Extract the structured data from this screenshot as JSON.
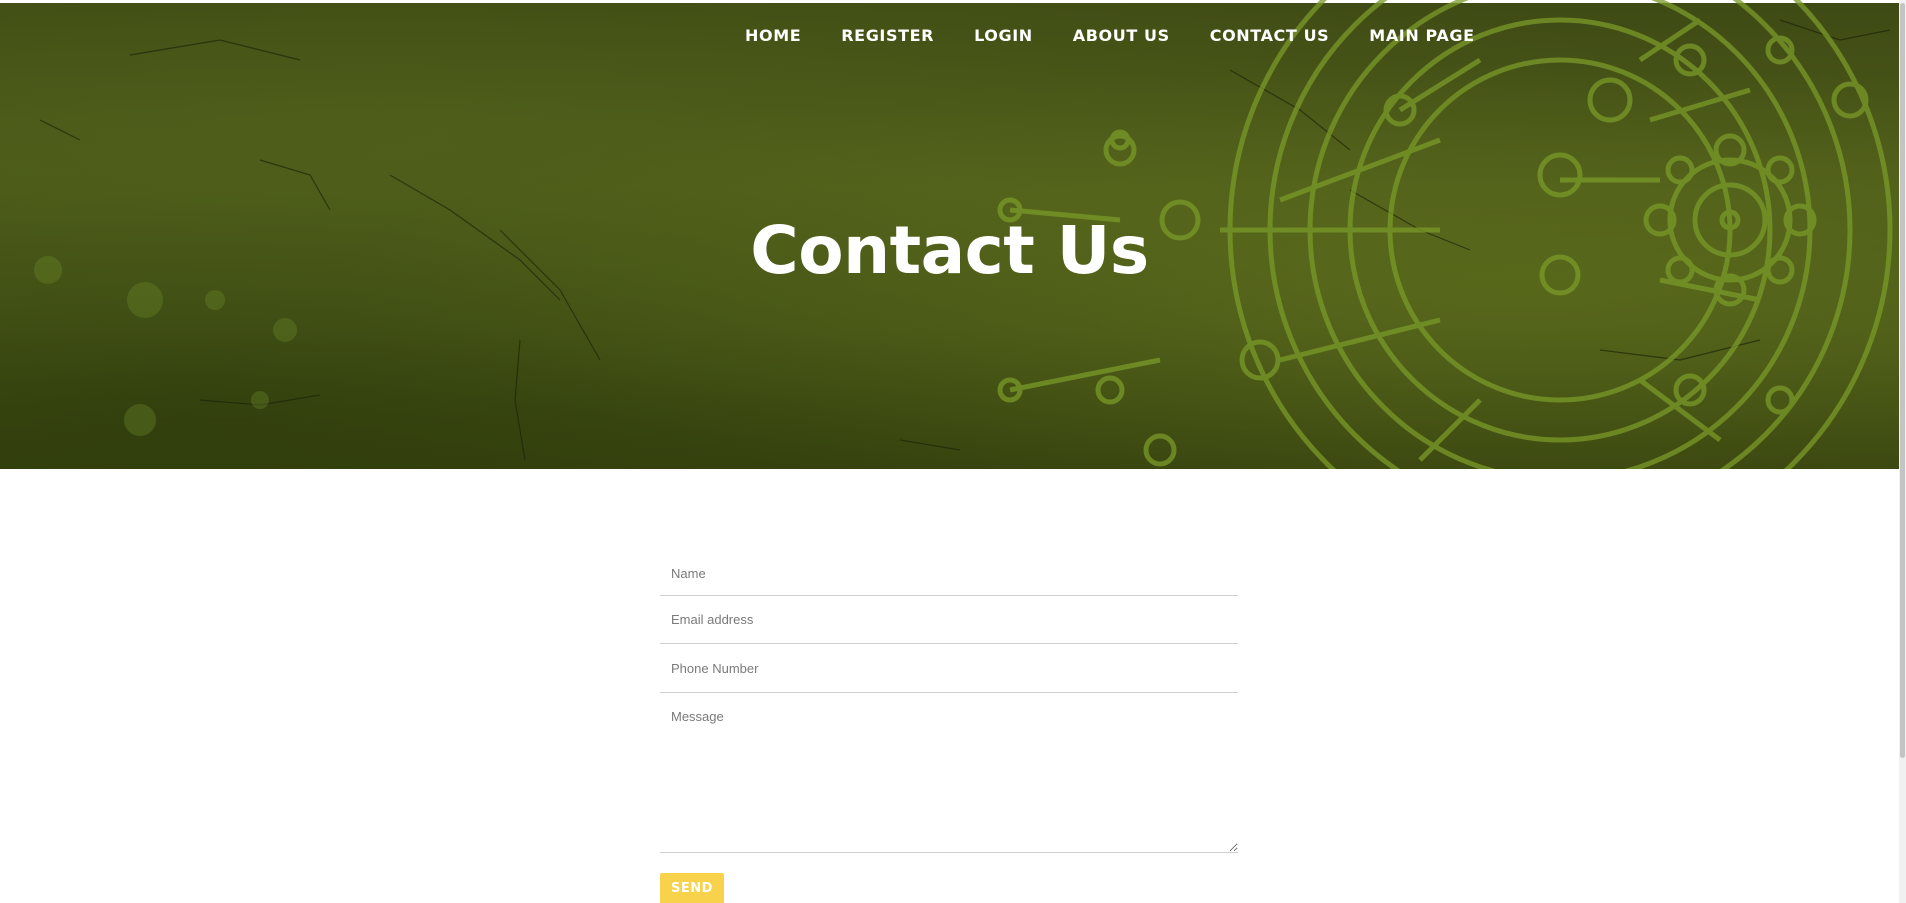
{
  "nav": {
    "items": [
      {
        "label": "HOME"
      },
      {
        "label": "REGISTER"
      },
      {
        "label": "LOGIN"
      },
      {
        "label": "ABOUT US"
      },
      {
        "label": "CONTACT US"
      },
      {
        "label": "MAIN PAGE"
      }
    ]
  },
  "hero": {
    "title": "Contact Us"
  },
  "form": {
    "name_placeholder": "Name",
    "email_placeholder": "Email address",
    "phone_placeholder": "Phone Number",
    "message_placeholder": "Message",
    "send_label": "SEND"
  },
  "colors": {
    "hero_bg": "#4e5c1a",
    "mandala": "#7a9a28",
    "send_button": "#f7d24a",
    "nav_text": "#ffffff"
  }
}
